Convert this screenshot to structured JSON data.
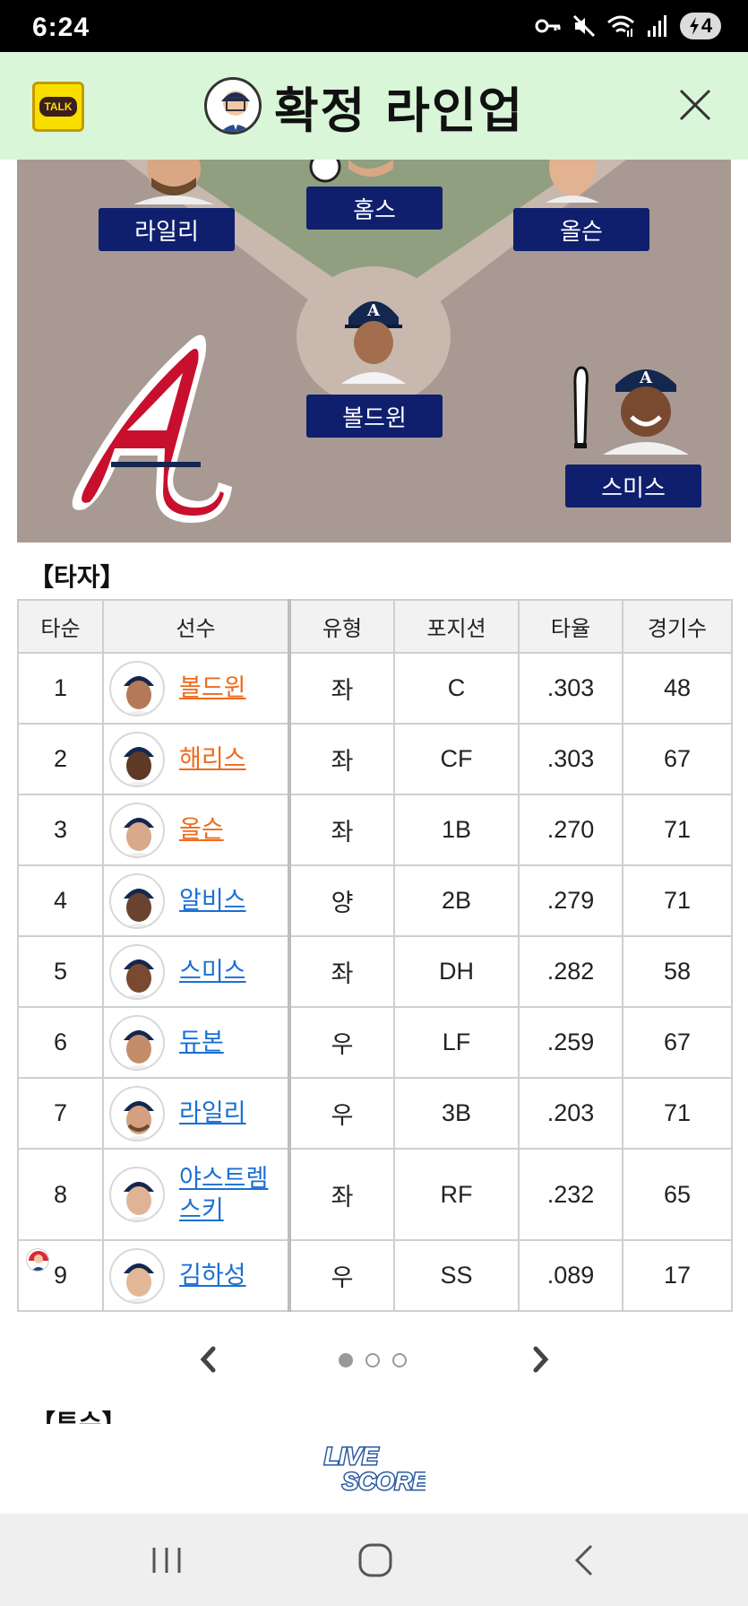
{
  "status_bar": {
    "time": "6:24",
    "battery_level": "4",
    "icons": [
      "vpn-key-icon",
      "mute-icon",
      "wifi-icon",
      "signal-icon",
      "battery-charging-icon"
    ]
  },
  "header": {
    "title": "확정 라인업",
    "talk_label": "TALK",
    "background": "#d9f7d8"
  },
  "field": {
    "players": {
      "third_base": "라일리",
      "pitcher": "홈스",
      "first_base": "올슨",
      "catcher": "볼드윈",
      "dh": "스미스"
    }
  },
  "batters": {
    "section_title": "【타자】",
    "columns": [
      "타순",
      "선수",
      "유형",
      "포지션",
      "타율",
      "경기수"
    ],
    "rows": [
      {
        "order": "1",
        "name": "볼드윈",
        "type": "좌",
        "position": "C",
        "avg": ".303",
        "games": "48",
        "name_color": "orange",
        "avg_highlight": true
      },
      {
        "order": "2",
        "name": "해리스",
        "type": "좌",
        "position": "CF",
        "avg": ".303",
        "games": "67",
        "name_color": "orange",
        "avg_highlight": true
      },
      {
        "order": "3",
        "name": "올슨",
        "type": "좌",
        "position": "1B",
        "avg": ".270",
        "games": "71",
        "name_color": "orange",
        "avg_highlight": false
      },
      {
        "order": "4",
        "name": "알비스",
        "type": "양",
        "position": "2B",
        "avg": ".279",
        "games": "71",
        "name_color": "blue",
        "avg_highlight": false
      },
      {
        "order": "5",
        "name": "스미스",
        "type": "좌",
        "position": "DH",
        "avg": ".282",
        "games": "58",
        "name_color": "blue",
        "avg_highlight": false
      },
      {
        "order": "6",
        "name": "듀본",
        "type": "우",
        "position": "LF",
        "avg": ".259",
        "games": "67",
        "name_color": "blue",
        "avg_highlight": false
      },
      {
        "order": "7",
        "name": "라일리",
        "type": "우",
        "position": "3B",
        "avg": ".203",
        "games": "71",
        "name_color": "blue",
        "avg_highlight": false
      },
      {
        "order": "8",
        "name_line1": "야스트렘",
        "name_line2": "스키",
        "type": "좌",
        "position": "RF",
        "avg": ".232",
        "games": "65",
        "name_color": "blue",
        "avg_highlight": false
      },
      {
        "order": "9",
        "name": "김하성",
        "type": "우",
        "position": "SS",
        "avg": ".089",
        "games": "17",
        "name_color": "blue",
        "avg_highlight": false,
        "korean_badge": true
      }
    ]
  },
  "pager": {
    "pages": 3,
    "active_page": 1
  },
  "next_section_title": "【투수】",
  "footer": {
    "logo_line1": "LIVE",
    "logo_line2": "SCORE"
  },
  "colors": {
    "orange_link": "#ef6a1c",
    "blue_link": "#1a6fd4",
    "highlight_avg": "#e0202c",
    "name_tag": "#0f1f6e"
  }
}
